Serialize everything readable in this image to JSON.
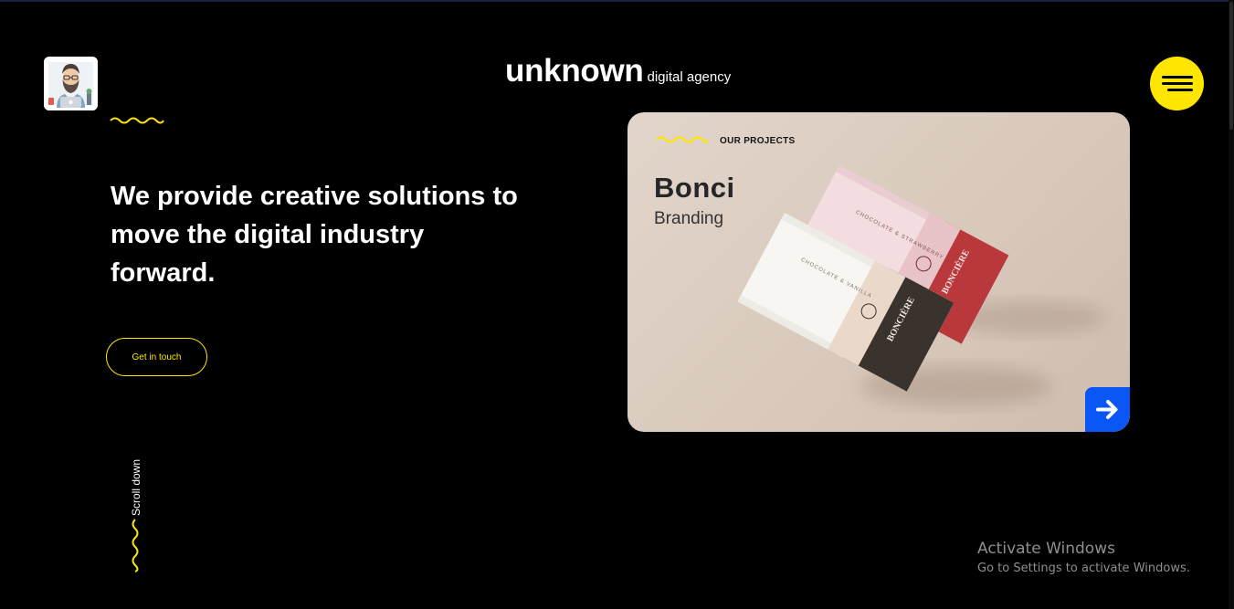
{
  "brand": {
    "name": "unknown",
    "tagline": "digital agency"
  },
  "header": {
    "avatar_icon": "bearded-man-avatar-icon",
    "menu_icon": "hamburger-menu-icon"
  },
  "hero": {
    "headline": "We provide creative solutions to move the digital industry forward.",
    "cta_label": "Get in touch",
    "scroll_label": "Scroll down"
  },
  "project_card": {
    "eyebrow": "OUR PROJECTS",
    "title": "Bonci",
    "subtitle": "Branding",
    "image_icon": "chocolate-bar-packaging-mockup",
    "arrow_icon": "arrow-right-icon",
    "packages": [
      {
        "flavor": "CHOCOLATE & STRAWBERRY",
        "brand_mark": "BONCIÈRE"
      },
      {
        "flavor": "CHOCOLATE & VANILLA",
        "brand_mark": "BONCIÈRE"
      }
    ]
  },
  "watermark": {
    "title": "Activate Windows",
    "subtitle": "Go to Settings to activate Windows."
  },
  "colors": {
    "background": "#000000",
    "accent_yellow": "#ffe600",
    "accent_blue": "#0b57f5",
    "card_bg": "#dcccbf",
    "text": "#ffffff"
  }
}
